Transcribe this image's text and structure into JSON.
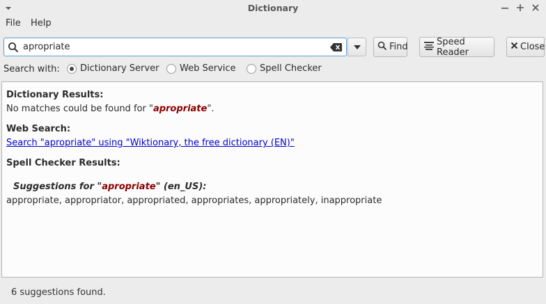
{
  "window": {
    "title": "Dictionary"
  },
  "menu": {
    "file": "File",
    "help": "Help"
  },
  "search": {
    "value": "apropriate"
  },
  "buttons": {
    "find": "Find",
    "speed_reader": "Speed Reader",
    "close": "Close"
  },
  "search_with": {
    "label": "Search with:",
    "options": [
      "Dictionary Server",
      "Web Service",
      "Spell Checker"
    ],
    "selected": "Dictionary Server"
  },
  "results": {
    "dict_heading": "Dictionary Results:",
    "dict_msg_prefix": "No matches could be found for \"",
    "dict_word": "apropriate",
    "dict_msg_suffix": "\".",
    "web_heading": "Web Search:",
    "web_link": "Search \"apropriate\" using \"Wiktionary, the free dictionary (EN)\"",
    "spell_heading": "Spell Checker Results:",
    "sugg_prefix": "Suggestions for \"",
    "sugg_word": "apropriate",
    "sugg_suffix": "\" (en_US):",
    "suggestions": "appropriate, appropriator, appropriated, appropriates, appropriately, inappropriate"
  },
  "status": "6 suggestions found.",
  "colors": {
    "accent_border": "#5b9bd5",
    "word": "#8b0000",
    "link": "#0000d0"
  }
}
